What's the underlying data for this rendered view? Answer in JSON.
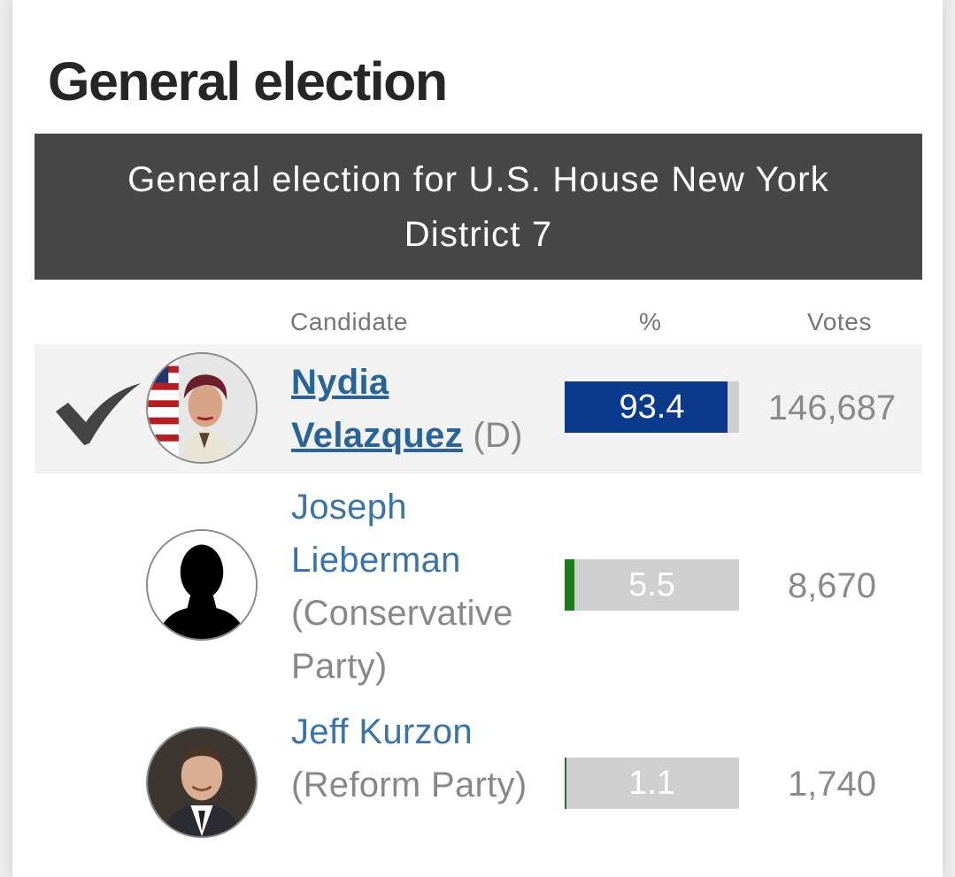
{
  "page": {
    "section_title": "General election",
    "race_title": "General election for U.S. House New York District 7"
  },
  "table": {
    "headers": {
      "candidate": "Candidate",
      "percent": "%",
      "votes": "Votes"
    },
    "rows": [
      {
        "name": "Nydia Velazquez",
        "party": "(D)",
        "percent": "93.4",
        "percent_value": 93.4,
        "votes": "146,687",
        "winner": true,
        "bar_color": "#0b3a8c",
        "avatar": "candidate-photo-icon"
      },
      {
        "name": "Joseph Lieberman",
        "party": "(Conservative Party)",
        "percent": "5.5",
        "percent_value": 5.5,
        "votes": "8,670",
        "winner": false,
        "bar_color": "#1e7a1e",
        "avatar": "silhouette-icon"
      },
      {
        "name": "Jeff Kurzon",
        "party": "(Reform Party)",
        "percent": "1.1",
        "percent_value": 1.1,
        "votes": "1,740",
        "winner": false,
        "bar_color": "#1e7a1e",
        "avatar": "candidate-photo-icon"
      }
    ]
  },
  "colors": {
    "header_bg": "#474747",
    "link": "#2a6496",
    "bar_bg": "#cfcfcf",
    "winner_row_bg": "#f2f2f2"
  }
}
